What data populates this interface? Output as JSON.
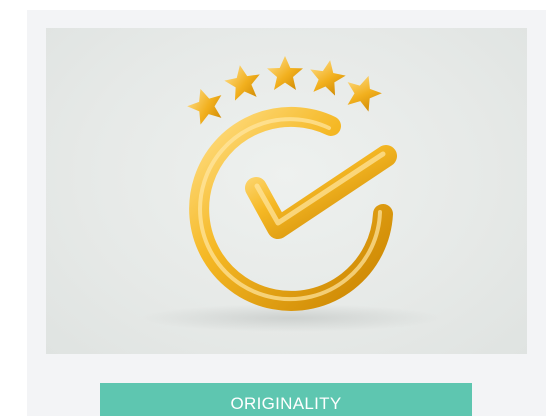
{
  "card": {
    "label": "ORIGINALITY",
    "image": {
      "subject": "golden-check-mark-with-five-stars",
      "stars": 5,
      "colors": {
        "gold": "#f2b01e",
        "gold_light": "#ffd76a",
        "gold_dark": "#c98300",
        "background": "#e6e9e7",
        "label_background": "#5ec6b0",
        "label_text": "#ffffff"
      }
    }
  }
}
